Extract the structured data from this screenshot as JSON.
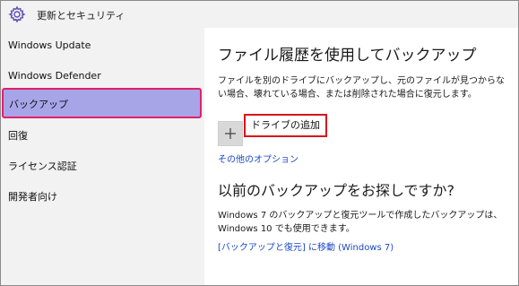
{
  "window": {
    "title": "更新とセキュリティ",
    "icon": "gear-icon"
  },
  "sidebar": {
    "items": [
      {
        "label": "Windows Update"
      },
      {
        "label": "Windows Defender"
      },
      {
        "label": "バックアップ",
        "selected": true
      },
      {
        "label": "回復"
      },
      {
        "label": "ライセンス認証"
      },
      {
        "label": "開発者向け"
      }
    ],
    "selected_color": "#a8a4e8",
    "highlight_border_color": "#e0206a"
  },
  "main": {
    "heading": "ファイル履歴を使用してバックアップ",
    "description": "ファイルを別のドライブにバックアップし、元のファイルが見つからない場合、壊れている場合、または削除された場合に復元します。",
    "add_drive_label": "ドライブの追加",
    "add_drive_icon": "plus-icon",
    "more_options_link": "その他のオプション",
    "old_backup_heading": "以前のバックアップをお探しですか?",
    "old_backup_description": "Windows 7 のバックアップと復元ツールで作成したバックアップは、Windows 10 でも使用できます。",
    "restore_link": "[バックアップと復元] に移動 (Windows 7)",
    "link_color": "#1b48c8",
    "callout_color": "#d9141b"
  }
}
